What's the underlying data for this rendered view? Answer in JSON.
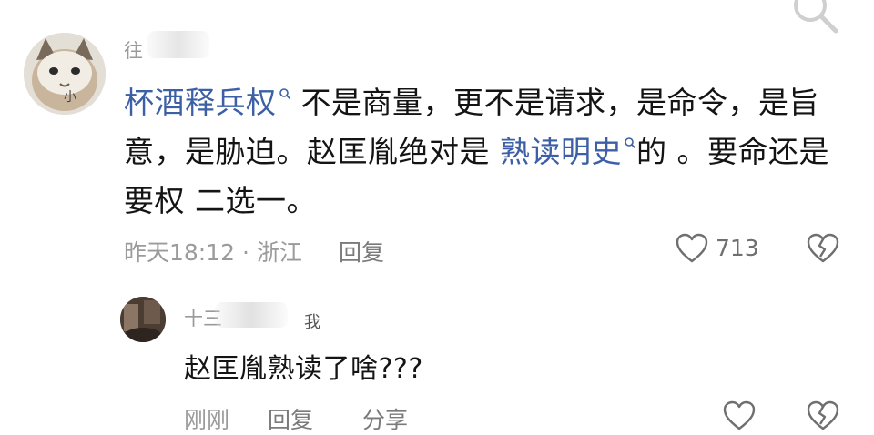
{
  "icons": {
    "search": "search-icon",
    "like": "heart-outline-icon",
    "dislike": "broken-heart-icon"
  },
  "colors": {
    "link": "#3c5fa5",
    "text": "#141414",
    "meta": "#9b9b9b",
    "background": "#ffffff"
  },
  "comment": {
    "username_visible": "往",
    "body_link1": "杯酒释兵权",
    "body_text1": " 不是商量，更不是请求，是命令，是旨意，是胁迫。赵匡胤绝对是 ",
    "body_link2": "熟读明史",
    "body_text2": "的 。要命还是要权 二选一。",
    "time_location": "昨天18:12 · 浙江",
    "reply_label": "回复",
    "like_count": "713"
  },
  "reply": {
    "username_visible": "十三",
    "badge": "我",
    "body": "赵匡胤熟读了啥???",
    "time": "刚刚",
    "reply_label": "回复",
    "share_label": "分享"
  }
}
